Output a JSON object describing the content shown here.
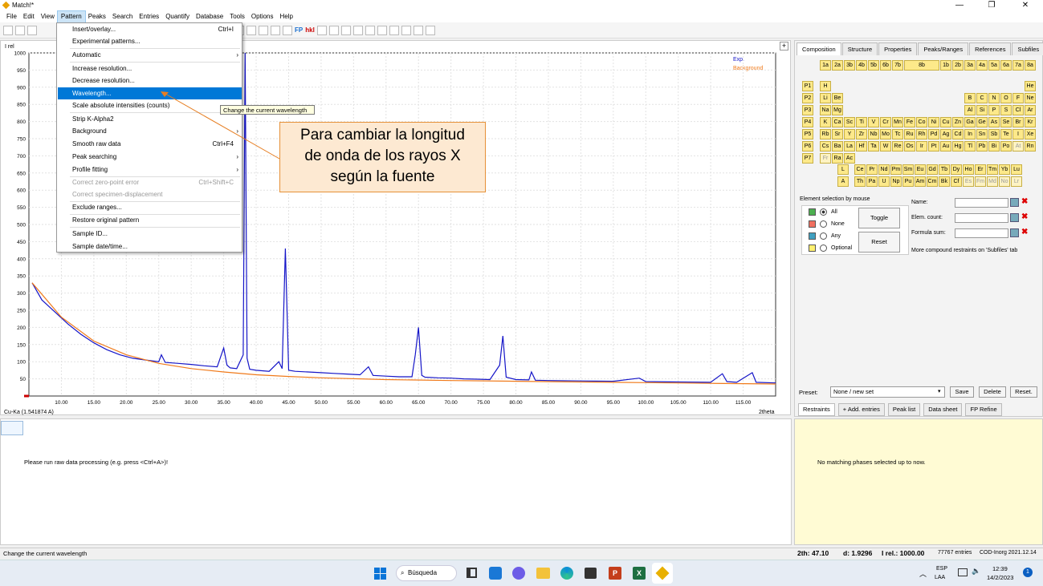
{
  "window": {
    "title": "Match!*"
  },
  "menu": [
    "File",
    "Edit",
    "View",
    "Pattern",
    "Peaks",
    "Search",
    "Entries",
    "Quantify",
    "Database",
    "Tools",
    "Options",
    "Help"
  ],
  "pattern_menu": [
    {
      "label": "Insert/overlay...",
      "shortcut": "Ctrl+I"
    },
    {
      "label": "Experimental patterns...",
      "shortcut": ""
    },
    {
      "label": "Automatic",
      "shortcut": ""
    },
    {
      "label": "Increase resolution...",
      "shortcut": ""
    },
    {
      "label": "Decrease resolution...",
      "shortcut": ""
    },
    {
      "label": "Wavelength...",
      "shortcut": ""
    },
    {
      "label": "Scale absolute intensities (counts)",
      "shortcut": ""
    },
    {
      "label": "Strip K-Alpha2",
      "shortcut": ""
    },
    {
      "label": "Background",
      "shortcut": ""
    },
    {
      "label": "Smooth raw data",
      "shortcut": "Ctrl+F4"
    },
    {
      "label": "Peak searching",
      "shortcut": ""
    },
    {
      "label": "Profile fitting",
      "shortcut": ""
    },
    {
      "label": "Correct zero-point error",
      "shortcut": "Ctrl+Shift+C"
    },
    {
      "label": "Correct specimen-displacement",
      "shortcut": ""
    },
    {
      "label": "Exclude ranges...",
      "shortcut": ""
    },
    {
      "label": "Restore original pattern",
      "shortcut": ""
    },
    {
      "label": "Sample ID...",
      "shortcut": ""
    },
    {
      "label": "Sample date/time...",
      "shortcut": ""
    }
  ],
  "tooltip": "Change the current wavelength",
  "callout": {
    "line1": "Para cambiar la longitud",
    "line2": "de onda de los rayos X",
    "line3": "según la fuente"
  },
  "chart_data": {
    "type": "line",
    "ylabel": "I rel",
    "xlabel": "2theta",
    "wavelength_label": "Cu-Ka (1.541874 A)",
    "legend": [
      "Exp.",
      "Background"
    ],
    "colors": {
      "exp": "#1515c8",
      "background": "#f07a1a"
    },
    "xlim": [
      5,
      120
    ],
    "ylim": [
      0,
      1000
    ],
    "yticks": [
      50,
      100,
      150,
      200,
      250,
      300,
      350,
      400,
      450,
      500,
      550,
      600,
      650,
      700,
      750,
      800,
      850,
      900,
      950,
      1000
    ],
    "xticks": [
      10,
      15,
      20,
      25,
      30,
      35,
      40,
      45,
      50,
      55,
      60,
      65,
      70,
      75,
      80,
      85,
      90,
      95,
      100,
      105,
      110,
      115
    ],
    "x": [
      5.5,
      7,
      9,
      11,
      13,
      15,
      17,
      19,
      21,
      23,
      25,
      25.4,
      26,
      28,
      30,
      32,
      34,
      35,
      35.5,
      36,
      37,
      38,
      38.3,
      38.6,
      39,
      40,
      42,
      43.5,
      44,
      44.5,
      45,
      46,
      48,
      50,
      52,
      54,
      56,
      57.3,
      58,
      60,
      62,
      64,
      64.5,
      65,
      65.5,
      66,
      68,
      70,
      72,
      74,
      76,
      77.5,
      78,
      78.5,
      80,
      82,
      82.4,
      83,
      85,
      90,
      95,
      99,
      100,
      105,
      110,
      111.8,
      112.5,
      114,
      116.4,
      117,
      120
    ],
    "y": [
      330,
      280,
      245,
      210,
      180,
      155,
      135,
      120,
      110,
      105,
      100,
      120,
      98,
      95,
      92,
      88,
      85,
      140,
      90,
      82,
      80,
      120,
      1000,
      110,
      78,
      75,
      72,
      100,
      80,
      430,
      75,
      72,
      70,
      68,
      66,
      64,
      62,
      85,
      60,
      58,
      56,
      56,
      120,
      200,
      60,
      55,
      53,
      52,
      50,
      49,
      48,
      90,
      175,
      55,
      48,
      47,
      70,
      46,
      45,
      44,
      43,
      52,
      42,
      41,
      40,
      65,
      42,
      40,
      68,
      40,
      38
    ],
    "bg_x": [
      5.5,
      10,
      15,
      20,
      25,
      30,
      35,
      40,
      45,
      50,
      60,
      70,
      80,
      90,
      100,
      110,
      120
    ],
    "bg_y": [
      330,
      230,
      160,
      120,
      95,
      80,
      70,
      62,
      57,
      53,
      48,
      45,
      43,
      41,
      39,
      37,
      35
    ]
  },
  "right_panel": {
    "tabs": [
      "Composition",
      "Structure",
      "Properties",
      "Peaks/Ranges",
      "References",
      "Subfiles"
    ],
    "groups": [
      "1a",
      "2a",
      "3b",
      "4b",
      "5b",
      "6b",
      "7b",
      "8b",
      "1b",
      "2b",
      "3a",
      "4a",
      "5a",
      "6a",
      "7a",
      "8a"
    ],
    "periods": [
      "P1",
      "P2",
      "P3",
      "P4",
      "P5",
      "P6",
      "P7"
    ],
    "elements": [
      [
        "H",
        "",
        "",
        "",
        "",
        "",
        "",
        "",
        "",
        "",
        "",
        "",
        "",
        "",
        "",
        "",
        "",
        "He"
      ],
      [
        "Li",
        "Be",
        "",
        "",
        "",
        "",
        "",
        "",
        "",
        "",
        "",
        "",
        "B",
        "C",
        "N",
        "O",
        "F",
        "Ne"
      ],
      [
        "Na",
        "Mg",
        "",
        "",
        "",
        "",
        "",
        "",
        "",
        "",
        "",
        "",
        "Al",
        "Si",
        "P",
        "S",
        "Cl",
        "Ar"
      ],
      [
        "K",
        "Ca",
        "Sc",
        "Ti",
        "V",
        "Cr",
        "Mn",
        "Fe",
        "Co",
        "Ni",
        "Cu",
        "Zn",
        "Ga",
        "Ge",
        "As",
        "Se",
        "Br",
        "Kr"
      ],
      [
        "Rb",
        "Sr",
        "Y",
        "Zr",
        "Nb",
        "Mo",
        "Tc",
        "Ru",
        "Rh",
        "Pd",
        "Ag",
        "Cd",
        "In",
        "Sn",
        "Sb",
        "Te",
        "I",
        "Xe"
      ],
      [
        "Cs",
        "Ba",
        "La",
        "Hf",
        "Ta",
        "W",
        "Re",
        "Os",
        "Ir",
        "Pt",
        "Au",
        "Hg",
        "Tl",
        "Pb",
        "Bi",
        "Po",
        "At",
        "Rn"
      ],
      [
        "Fr",
        "Ra",
        "Ac",
        "",
        "",
        "",
        "",
        "",
        "",
        "",
        "",
        "",
        "",
        "",
        "",
        "",
        "",
        ""
      ]
    ],
    "lanthanides": [
      "Ce",
      "Pr",
      "Nd",
      "Pm",
      "Sm",
      "Eu",
      "Gd",
      "Tb",
      "Dy",
      "Ho",
      "Er",
      "Tm",
      "Yb",
      "Lu"
    ],
    "actinides": [
      "Th",
      "Pa",
      "U",
      "Np",
      "Pu",
      "Am",
      "Cm",
      "Bk",
      "Cf",
      "Es",
      "Fm",
      "Md",
      "No",
      "Lr"
    ],
    "L_label": "L",
    "A_label": "A",
    "selection_title": "Element selection by mouse",
    "selection_opts": [
      "All",
      "None",
      "Any",
      "Optional"
    ],
    "toggle": "Toggle",
    "reset": "Reset",
    "name_label": "Name:",
    "count_label": "Elem. count:",
    "formula_label": "Formula sum:",
    "more": "More compound restraints on 'Subfiles' tab",
    "preset_label": "Preset:",
    "preset_value": "None / new set",
    "save": "Save",
    "delete": "Delete",
    "reset2": "Reset.",
    "bottom_tabs": [
      "Restraints",
      "+ Add. entries",
      "Peak list",
      "Data sheet",
      "FP Refine"
    ]
  },
  "lower_left": "Please run raw data processing (e.g. press <Ctrl+A>)!",
  "lower_right": "No matching phases selected up to now.",
  "status": {
    "left": "Change the current wavelength",
    "twoth": "2th:  47.10",
    "d": "d: 1.9296",
    "irel": "I rel.: 1000.00",
    "entries": "77767 entries",
    "db": "COD-Inorg 2021.12.14"
  },
  "taskbar": {
    "search": "Búsqueda",
    "lang1": "ESP",
    "lang2": "LAA",
    "time": "12:39",
    "date": "14/2/2023",
    "notif": "1"
  }
}
